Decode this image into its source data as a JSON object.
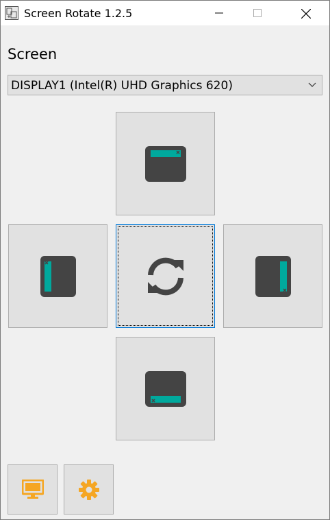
{
  "window": {
    "title": "Screen Rotate 1.2.5"
  },
  "screen_section": {
    "label": "Screen",
    "selected_display": "DISPLAY1 (Intel(R) UHD Graphics 620)"
  },
  "rotation_buttons": {
    "top_icon": "landscape-icon",
    "left_icon": "portrait-left-icon",
    "center_icon": "rotate-sync-icon",
    "right_icon": "portrait-right-icon",
    "bottom_icon": "landscape-flipped-icon"
  },
  "toolbar": {
    "monitor_icon": "monitor-icon",
    "settings_icon": "gear-icon"
  },
  "colors": {
    "accent_teal": "#00a99d",
    "icon_dark": "#444444",
    "accent_orange": "#f5a623",
    "focus_blue": "#0078d7"
  }
}
